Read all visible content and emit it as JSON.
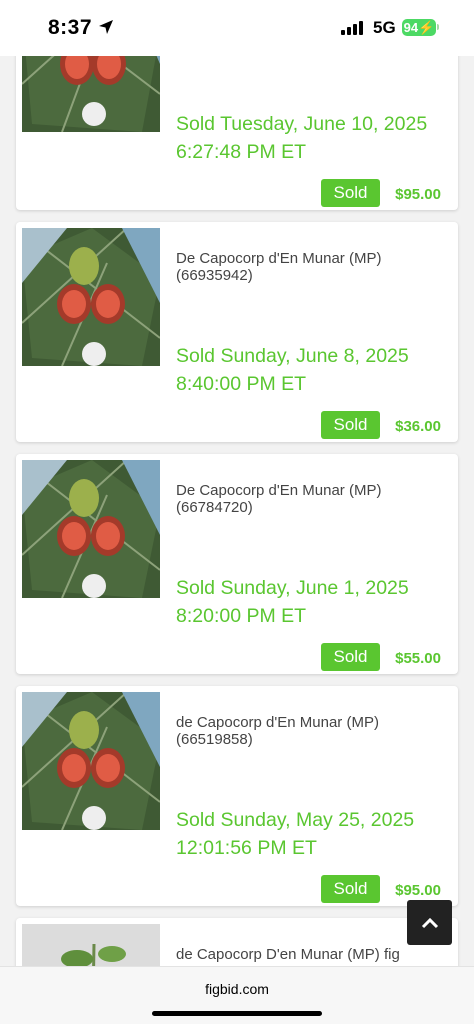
{
  "status_bar": {
    "time": "8:37",
    "network": "5G",
    "battery": "94"
  },
  "listings": [
    {
      "title": "",
      "sold_line1": "Sold Tuesday, June 10, 2025",
      "sold_line2": "6:27:48 PM ET",
      "badge": "Sold",
      "price": "$95.00"
    },
    {
      "title": "De Capocorp d'En Munar (MP) (66935942)",
      "sold_line1": "Sold Sunday, June 8, 2025",
      "sold_line2": "8:40:00 PM ET",
      "badge": "Sold",
      "price": "$36.00"
    },
    {
      "title": "De Capocorp d'En Munar (MP) (66784720)",
      "sold_line1": "Sold Sunday, June 1, 2025",
      "sold_line2": "8:20:00 PM ET",
      "badge": "Sold",
      "price": "$55.00"
    },
    {
      "title": "de Capocorp d'En Munar (MP) (66519858)",
      "sold_line1": "Sold Sunday, May 25, 2025",
      "sold_line2": "12:01:56 PM ET",
      "badge": "Sold",
      "price": "$95.00"
    },
    {
      "title": "de Capocorp D'en Munar (MP) fig"
    }
  ],
  "browser": {
    "url": "figbid.com"
  },
  "icons": {
    "scroll_top": "chevron-up-icon",
    "location": "location-arrow-icon",
    "signal": "signal-bars-icon",
    "battery": "battery-icon"
  }
}
